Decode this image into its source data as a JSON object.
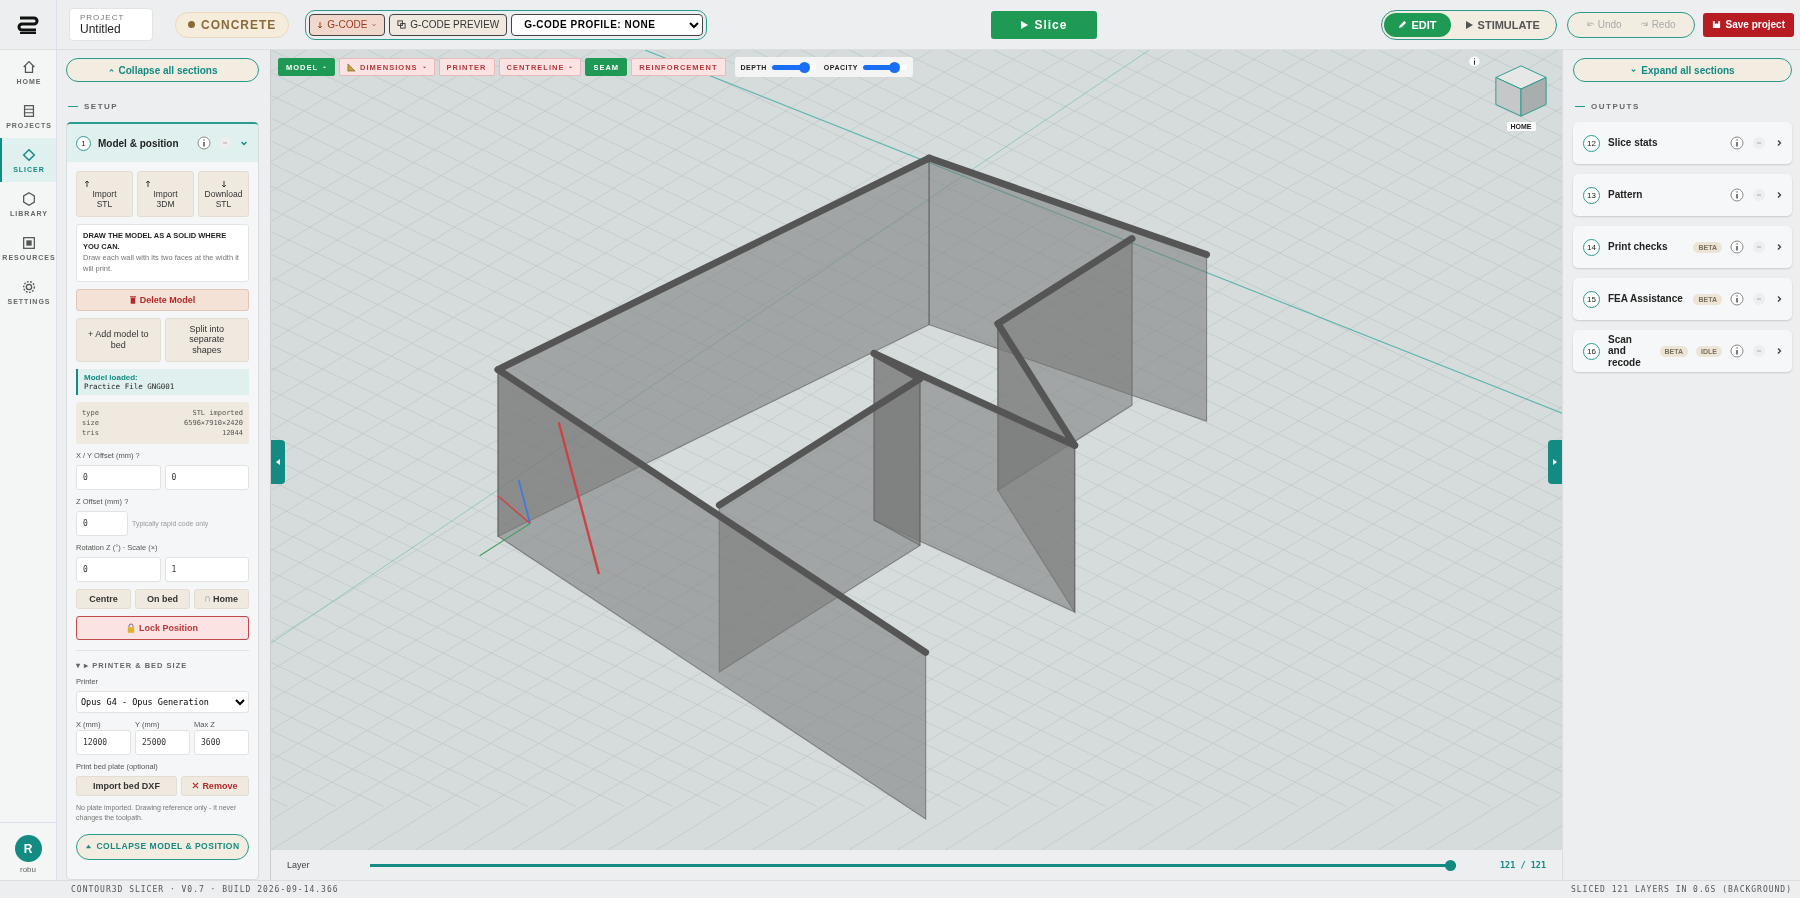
{
  "top_bar": {
    "project_label": "PROJECT",
    "project_name": "Untitled",
    "material": "CONCRETE",
    "gcode_button": "G-CODE",
    "gcode_preview_button": "G-CODE PREVIEW",
    "profile_select": "G-CODE PROFILE: NONE",
    "slice_button": "Slice",
    "modes": [
      {
        "label": "EDIT",
        "selected": true
      },
      {
        "label": "STIMULATE",
        "selected": false
      }
    ],
    "history": [
      {
        "label": "Undo",
        "disabled": true
      },
      {
        "label": "Redo",
        "disabled": true
      }
    ],
    "save_button": "Save project"
  },
  "nav": {
    "items": [
      {
        "label": "HOME",
        "selected": false
      },
      {
        "label": "PROJECTS",
        "selected": false
      },
      {
        "label": "SLICER",
        "selected": true
      },
      {
        "label": "LIBRARY",
        "selected": false
      },
      {
        "label": "RESOURCES",
        "selected": false
      },
      {
        "label": "SETTINGS",
        "selected": false
      }
    ],
    "user": {
      "initial": "R",
      "name": "robu"
    }
  },
  "left_panel": {
    "collapse_all": "Collapse all sections",
    "heading": "SETUP",
    "section": {
      "number": "1",
      "title": "Model & position",
      "expanded": true
    },
    "import_buttons": [
      {
        "label": "Import STL",
        "kind": "up"
      },
      {
        "label": "Import 3DM",
        "kind": "up"
      },
      {
        "label": "Download STL",
        "kind": "down"
      }
    ],
    "note": {
      "title": "DRAW THE MODEL AS A SOLID WHERE YOU CAN.",
      "body": "Draw each wall with its two faces at the width it will print."
    },
    "delete_button": "Delete Model",
    "model_buttons": [
      "+ Add model to bed",
      "Split into separate shapes"
    ],
    "loaded": {
      "label": "Model loaded:",
      "file": "Practice File GNG001"
    },
    "info": [
      {
        "key": "type",
        "value": "STL imported"
      },
      {
        "key": "size",
        "value": "6596×7910×2420"
      },
      {
        "key": "tris",
        "value": "12044"
      }
    ],
    "xy_offset": {
      "label": "X / Y Offset (mm) ?",
      "values": [
        "0",
        "0"
      ]
    },
    "z_offset": {
      "label": "Z Offset (mm) ?",
      "value": "0",
      "hint": "Typically rapid code only"
    },
    "rotation_scale": {
      "label": "Rotation Z (°) · Scale (×)",
      "values": [
        "0",
        "1"
      ]
    },
    "position_buttons": [
      "Centre",
      "On bed",
      "Home"
    ],
    "lock_button": "Lock Position",
    "printer_heading": "▾ ▸ PRINTER & BED SIZE",
    "printer": {
      "label": "Printer",
      "value": "Opus G4 - Opus Generation"
    },
    "bed_size": [
      {
        "label": "X (mm)",
        "value": "12000"
      },
      {
        "label": "Y (mm)",
        "value": "25000"
      },
      {
        "label": "Max Z",
        "value": "3600"
      }
    ],
    "bed_plate": {
      "label": "Print bed plate (optional)",
      "import_button": "Import bed DXF",
      "remove_button": "Remove",
      "note": "No plate imported. Drawing reference only - it never changes the toolpath."
    },
    "collapse_section": "COLLAPSE MODEL & POSITION"
  },
  "viewport": {
    "toolbar": [
      {
        "label": "MODEL",
        "on": true,
        "dropdown": true,
        "ruler": false
      },
      {
        "label": "DIMENSIONS",
        "on": false,
        "dropdown": true,
        "ruler": true
      },
      {
        "label": "PRINTER",
        "on": false,
        "dropdown": false,
        "ruler": false
      },
      {
        "label": "CENTRELINE",
        "on": false,
        "dropdown": true,
        "ruler": false
      },
      {
        "label": "SEAM",
        "on": true,
        "dropdown": false,
        "ruler": false
      },
      {
        "label": "REINFORCEMENT",
        "on": false,
        "dropdown": false,
        "ruler": false
      }
    ],
    "sliders": [
      {
        "label": "DEPTH",
        "level": 0.82
      },
      {
        "label": "OPACITY",
        "level": 0.78
      }
    ],
    "view_cube_label": "HOME",
    "layer": {
      "label": "Layer",
      "level": 1,
      "reading": "121 / 121"
    }
  },
  "right_panel": {
    "expand_all": "Expand all sections",
    "heading": "OUTPUTS",
    "sections": [
      {
        "number": "12",
        "title": "Slice stats",
        "expanded": false
      },
      {
        "number": "13",
        "title": "Pattern",
        "expanded": false
      },
      {
        "number": "14",
        "title": "Print checks",
        "expanded": false,
        "badges": [
          "BETA"
        ]
      },
      {
        "number": "15",
        "title": "FEA Assistance",
        "expanded": false,
        "badges": [
          "BETA"
        ]
      },
      {
        "number": "16",
        "title": "Scan and recode",
        "expanded": false,
        "badges": [
          "BETA",
          "IDLE"
        ]
      }
    ]
  },
  "status_bar": {
    "left": "CONTOUR3D SLICER · V0.7 · BUILD 2026-09-14.366",
    "right": "SLICED 121 LAYERS IN 0.6S (BACKGROUND)"
  }
}
